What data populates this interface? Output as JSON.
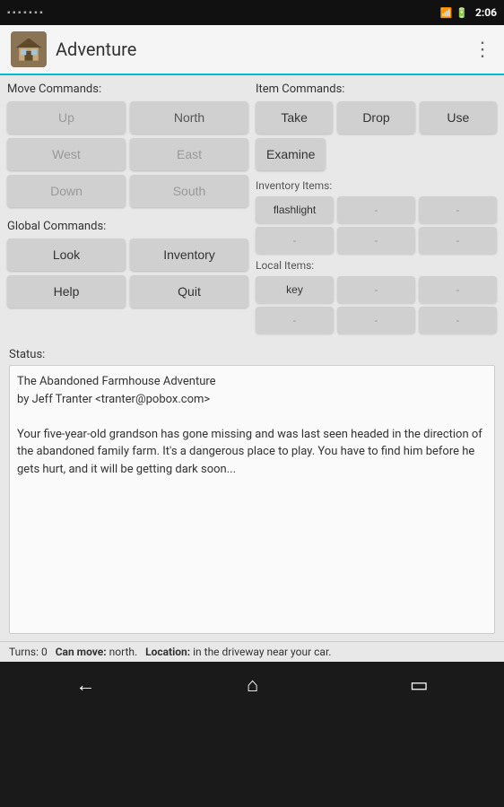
{
  "statusBar": {
    "time": "2:06",
    "batteryIcon": "🔋"
  },
  "titleBar": {
    "appTitle": "Adventure",
    "overflowIcon": "⋮"
  },
  "leftPanel": {
    "moveCommandsLabel": "Move Commands:",
    "buttons": {
      "up": "Up",
      "north": "North",
      "west": "West",
      "east": "East",
      "down": "Down",
      "south": "South"
    },
    "globalCommandsLabel": "Global Commands:",
    "globalButtons": {
      "look": "Look",
      "inventory": "Inventory",
      "help": "Help",
      "quit": "Quit"
    }
  },
  "rightPanel": {
    "itemCommandsLabel": "Item Commands:",
    "take": "Take",
    "drop": "Drop",
    "use": "Use",
    "examine": "Examine",
    "inventoryItemsLabel": "Inventory Items:",
    "inventoryItems": [
      {
        "label": "flashlight",
        "empty": false
      },
      {
        "label": "-",
        "empty": true
      },
      {
        "label": "-",
        "empty": true
      },
      {
        "label": "-",
        "empty": true
      },
      {
        "label": "-",
        "empty": true
      },
      {
        "label": "-",
        "empty": true
      }
    ],
    "localItemsLabel": "Local Items:",
    "localItems": [
      {
        "label": "key",
        "empty": false
      },
      {
        "label": "-",
        "empty": true
      },
      {
        "label": "-",
        "empty": true
      },
      {
        "label": "-",
        "empty": true
      },
      {
        "label": "-",
        "empty": true
      },
      {
        "label": "-",
        "empty": true
      }
    ]
  },
  "statusSection": {
    "label": "Status:",
    "text": "The Abandoned Farmhouse Adventure\nby Jeff Tranter <tranter@pobox.com>\n\nYour five-year-old grandson has gone missing and was last seen headed in the direction of the abandoned family farm. It's a dangerous place to play. You have to find him before he gets hurt, and it will be getting dark soon..."
  },
  "bottomStatus": {
    "turns_label": "Turns:",
    "turns_value": "0",
    "can_move_label": "Can move:",
    "can_move_value": "north.",
    "location_label": "Location:",
    "location_value": "in the driveway near your car."
  },
  "navBar": {
    "back": "←",
    "home": "⌂",
    "recents": "▭"
  }
}
